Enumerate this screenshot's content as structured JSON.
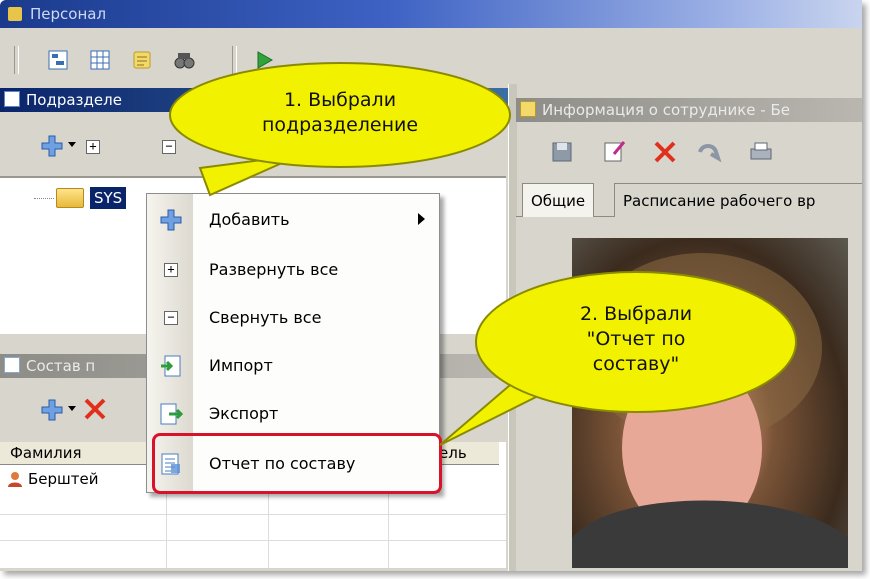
{
  "window": {
    "title": "Персонал"
  },
  "left_top_panel": {
    "title": "Подразделе"
  },
  "tree": {
    "selected_node": "SYS"
  },
  "left_bottom_panel": {
    "title": "Состав п"
  },
  "grid": {
    "columns": [
      "Фамилия",
      "ель"
    ],
    "rows": [
      [
        "Берштей"
      ]
    ]
  },
  "context_menu": {
    "items": [
      {
        "label": "Добавить",
        "icon": "add-icon",
        "submenu": true
      },
      {
        "label": "Развернуть все",
        "icon": "expand-icon"
      },
      {
        "label": "Свернуть все",
        "icon": "collapse-icon"
      },
      {
        "label": "Импорт",
        "icon": "import-icon"
      },
      {
        "label": "Экспорт",
        "icon": "export-icon"
      },
      {
        "label": "Отчет по составу",
        "icon": "report-icon"
      }
    ]
  },
  "right_panel": {
    "title": "Информация о сотруднике - Бе",
    "tabs": [
      "Общие",
      "Расписание рабочего вр"
    ]
  },
  "callouts": {
    "first": [
      "1. Выбрали",
      "подразделение"
    ],
    "second": [
      "2. Выбрали",
      "\"Отчет по",
      "составу\""
    ]
  },
  "colors": {
    "accent": "#0a246a",
    "highlight": "#d9122b",
    "callout": "#f2f200"
  }
}
